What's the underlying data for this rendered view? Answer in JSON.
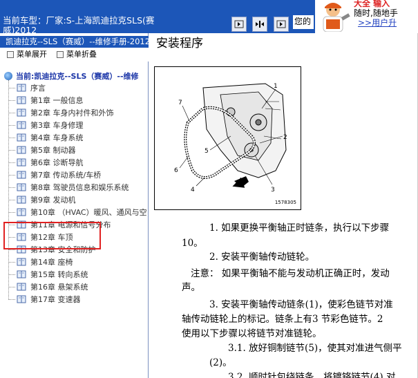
{
  "header": {
    "car_label_prefix": "当前车型：",
    "car_label_value": "厂家:S-上海凯迪拉克SLS(赛",
    "car_label_line2": "威)2012",
    "notice_text": "您的",
    "ad_line1": "大全 输入",
    "ad_line2": "随时,随地手",
    "ad_link": ">>用户升"
  },
  "left": {
    "manual_title": "凯迪拉克--SLS（赛威）--维修手册-2012",
    "menu_expand": "菜单展开",
    "menu_collapse": "菜单折叠",
    "root_label": "当前:凯迪拉克--SLS（赛威）--维修",
    "items": [
      {
        "label": "序言"
      },
      {
        "label": "第1章 一般信息"
      },
      {
        "label": "第2章 车身内衬件和外饰"
      },
      {
        "label": "第3章 车身修理"
      },
      {
        "label": "第4章 车身系统"
      },
      {
        "label": "第5章 制动器"
      },
      {
        "label": "第6章 诊断导航"
      },
      {
        "label": "第7章 传动系统/车桥"
      },
      {
        "label": "第8章 驾驶员信息和娱乐系统"
      },
      {
        "label": "第9章 发动机"
      },
      {
        "label": "第10章 （HVAC）暖风、通风与空"
      },
      {
        "label": "第11章 电源和信号分布"
      },
      {
        "label": "第12章 车顶"
      },
      {
        "label": "第13章 安全和防护"
      },
      {
        "label": "第14章 座椅"
      },
      {
        "label": "第15章 转向系统"
      },
      {
        "label": "第16章 悬架系统"
      },
      {
        "label": "第17章 变速器"
      }
    ]
  },
  "content": {
    "title": "安装程序",
    "figure_code": "1578305",
    "figure_callouts": [
      "1",
      "2",
      "3",
      "4",
      "5",
      "6",
      "7"
    ],
    "paragraphs": [
      "1. 如果更换平衡轴正时链条，执行以下步骤",
      "10。",
      "2. 安装平衡轴传动链轮。",
      "注意： 如果平衡轴不能与发动机正确正时，发动",
      "声。",
      "3. 安装平衡轴传动链条(1)，使彩色链节对准",
      "轴传动链轮上的标记。链条上有3 节彩色链节。2",
      "使用以下步骤以将链节对准链轮。",
      "3.1. 放好铜制链节(5)，使其对准进气侧平",
      "(2)。",
      "3.2. 顺时针包绕链条，将镀铬链节(4) 对"
    ]
  },
  "colors": {
    "header_bg": "#1c56b8",
    "highlight": "#e02020"
  }
}
